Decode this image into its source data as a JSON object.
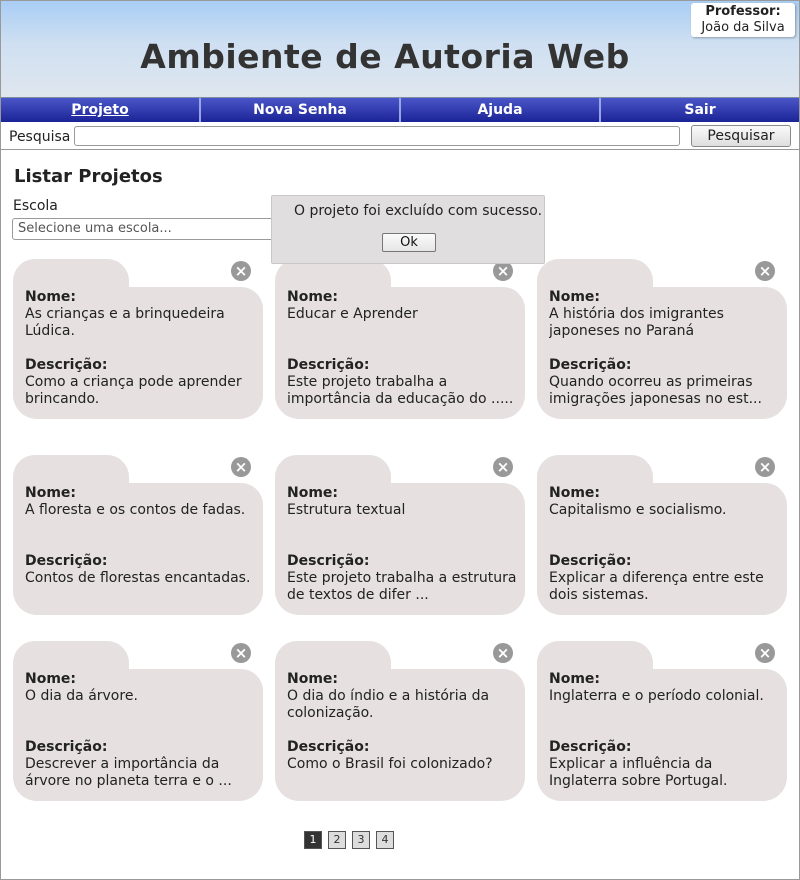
{
  "header": {
    "title": "Ambiente de Autoria Web",
    "professor_label": "Professor:",
    "professor_name": "João da Silva"
  },
  "nav": {
    "items": [
      "Projeto",
      "Nova Senha",
      "Ajuda",
      "Sair"
    ],
    "active": "Projeto"
  },
  "search": {
    "label": "Pesquisa",
    "value": "",
    "button": "Pesquisar"
  },
  "main": {
    "title": "Listar Projetos",
    "escola_label": "Escola",
    "escola_placeholder": "Selecione uma escola..."
  },
  "dialog": {
    "message": "O projeto foi excluído com sucesso.",
    "ok": "Ok"
  },
  "labels": {
    "nome": "Nome:",
    "descricao": "Descrição:"
  },
  "projects": [
    {
      "nome": "As crianças e a brinquedeira Lúdica.",
      "descricao": "Como a criança pode aprender brincando."
    },
    {
      "nome": "Educar e Aprender",
      "descricao": "Este projeto trabalha a importância da educação do ....."
    },
    {
      "nome": "A história dos imigrantes japoneses no Paraná",
      "descricao": "Quando ocorreu as primeiras imigrações japonesas no est..."
    },
    {
      "nome": "A floresta e os contos de fadas.",
      "descricao": "Contos de florestas encantadas."
    },
    {
      "nome": "Estrutura textual",
      "descricao": "Este projeto trabalha a estrutura de textos de difer ..."
    },
    {
      "nome": "Capitalismo e socialismo.",
      "descricao": "Explicar a diferença entre este dois sistemas."
    },
    {
      "nome": "O dia da árvore.",
      "descricao": "Descrever a importância da árvore no planeta terra e o  ..."
    },
    {
      "nome": "O dia do índio e a história da colonização.",
      "descricao": "Como o Brasil foi colonizado?"
    },
    {
      "nome": "Inglaterra e o período colonial.",
      "descricao": "Explicar a influência da Inglaterra sobre Portugal."
    }
  ],
  "pagination": {
    "pages": [
      "1",
      "2",
      "3",
      "4"
    ],
    "current": "1"
  },
  "icons": {
    "close": "close-icon"
  }
}
